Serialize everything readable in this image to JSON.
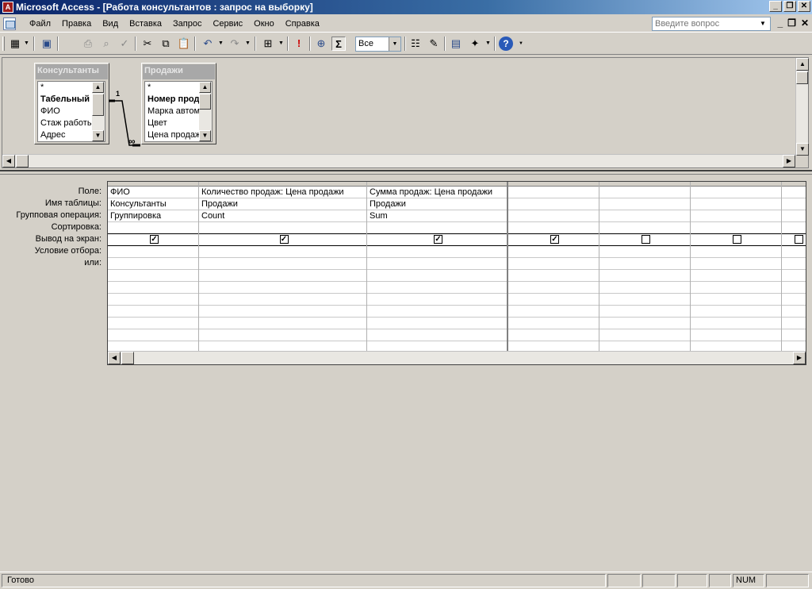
{
  "window": {
    "title": "Microsoft Access - [Работа консультантов : запрос на выборку]",
    "app_icon_text": "A"
  },
  "menu": {
    "items": [
      "Файл",
      "Правка",
      "Вид",
      "Вставка",
      "Запрос",
      "Сервис",
      "Окно",
      "Справка"
    ],
    "help_placeholder": "Введите вопрос"
  },
  "toolbar": {
    "top_values": "Все",
    "icons": [
      "view-icon",
      "save-icon",
      "print-icon",
      "print-preview-icon",
      "spelling-icon",
      "cut-icon",
      "copy-icon",
      "paste-icon",
      "undo-icon",
      "redo-icon",
      "query-type-icon",
      "run-icon",
      "show-table-icon",
      "totals-icon",
      "properties-icon",
      "build-icon",
      "database-window-icon",
      "new-object-icon",
      "help-icon"
    ],
    "totals_symbol": "Σ",
    "run_symbol": "!"
  },
  "tables": [
    {
      "title": "Консультанты",
      "fields": [
        {
          "name": "*",
          "key": false
        },
        {
          "name": "Табельный номер",
          "key": true
        },
        {
          "name": "ФИО",
          "key": false
        },
        {
          "name": "Стаж работы",
          "key": false
        },
        {
          "name": "Адрес",
          "key": false
        }
      ]
    },
    {
      "title": "Продажи",
      "fields": [
        {
          "name": "*",
          "key": false
        },
        {
          "name": "Номер продажи",
          "key": true
        },
        {
          "name": "Марка автомобиля",
          "key": false
        },
        {
          "name": "Цвет",
          "key": false
        },
        {
          "name": "Цена продажи",
          "key": false
        }
      ]
    }
  ],
  "relationship": {
    "one": "1",
    "many": "∞"
  },
  "grid": {
    "row_labels": [
      "Поле:",
      "Имя таблицы:",
      "Групповая операция:",
      "Сортировка:",
      "Вывод на экран:",
      "Условие отбора:",
      "или:"
    ],
    "columns": [
      {
        "field": "ФИО",
        "table": "Консультанты",
        "total": "Группировка",
        "sort": "",
        "show": true
      },
      {
        "field": "Количество продаж: Цена продажи",
        "table": "Продажи",
        "total": "Count",
        "sort": "",
        "show": true
      },
      {
        "field": "Сумма продаж: Цена продажи",
        "table": "Продажи",
        "total": "Sum",
        "sort": "",
        "show": true
      },
      {
        "field": "",
        "table": "",
        "total": "",
        "sort": "",
        "show": true
      },
      {
        "field": "",
        "table": "",
        "total": "",
        "sort": "",
        "show": false
      },
      {
        "field": "",
        "table": "",
        "total": "",
        "sort": "",
        "show": false
      },
      {
        "field": "",
        "table": "",
        "total": "",
        "sort": "",
        "show": false
      }
    ]
  },
  "status": {
    "text": "Готово",
    "num": "NUM"
  }
}
